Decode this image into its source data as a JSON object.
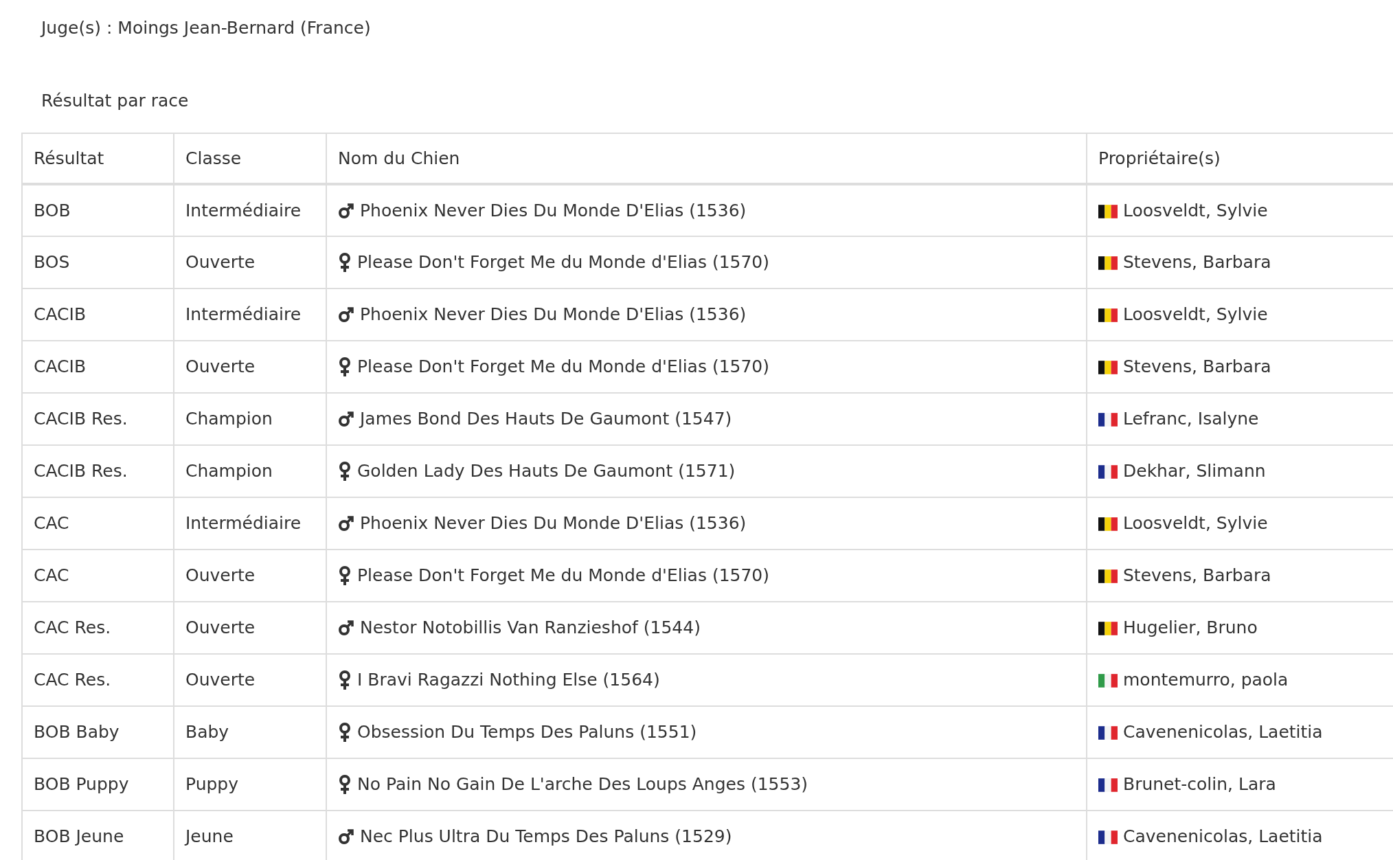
{
  "judge": "Juge(s) : Moings Jean-Bernard (France)",
  "section_title": "Résultat par race",
  "table": {
    "columns": [
      "Résultat",
      "Classe",
      "Nom du Chien",
      "Propriétaire(s)"
    ],
    "rows": [
      {
        "result": "BOB",
        "class": "Intermédiaire",
        "sex_icon": {
          "kind": "male"
        },
        "dog": "Phoenix Never Dies Du Monde D'Elias (1536)",
        "flag": {
          "kind": "belgium"
        },
        "owner": "Loosveldt, Sylvie"
      },
      {
        "result": "BOS",
        "class": "Ouverte",
        "sex_icon": {
          "kind": "female"
        },
        "dog": "Please Don't Forget Me du Monde d'Elias (1570)",
        "flag": {
          "kind": "belgium"
        },
        "owner": "Stevens, Barbara"
      },
      {
        "result": "CACIB",
        "class": "Intermédiaire",
        "sex_icon": {
          "kind": "male"
        },
        "dog": "Phoenix Never Dies Du Monde D'Elias (1536)",
        "flag": {
          "kind": "belgium"
        },
        "owner": "Loosveldt, Sylvie"
      },
      {
        "result": "CACIB",
        "class": "Ouverte",
        "sex_icon": {
          "kind": "female"
        },
        "dog": "Please Don't Forget Me du Monde d'Elias (1570)",
        "flag": {
          "kind": "belgium"
        },
        "owner": "Stevens, Barbara"
      },
      {
        "result": "CACIB Res.",
        "class": "Champion",
        "sex_icon": {
          "kind": "male"
        },
        "dog": "James Bond Des Hauts De Gaumont (1547)",
        "flag": {
          "kind": "france"
        },
        "owner": "Lefranc, Isalyne"
      },
      {
        "result": "CACIB Res.",
        "class": "Champion",
        "sex_icon": {
          "kind": "female"
        },
        "dog": "Golden Lady Des Hauts De Gaumont (1571)",
        "flag": {
          "kind": "france"
        },
        "owner": "Dekhar, Slimann"
      },
      {
        "result": "CAC",
        "class": "Intermédiaire",
        "sex_icon": {
          "kind": "male"
        },
        "dog": "Phoenix Never Dies Du Monde D'Elias (1536)",
        "flag": {
          "kind": "belgium"
        },
        "owner": "Loosveldt, Sylvie"
      },
      {
        "result": "CAC",
        "class": "Ouverte",
        "sex_icon": {
          "kind": "female"
        },
        "dog": "Please Don't Forget Me du Monde d'Elias (1570)",
        "flag": {
          "kind": "belgium"
        },
        "owner": "Stevens, Barbara"
      },
      {
        "result": "CAC Res.",
        "class": "Ouverte",
        "sex_icon": {
          "kind": "male"
        },
        "dog": "Nestor Notobillis Van Ranzieshof (1544)",
        "flag": {
          "kind": "belgium"
        },
        "owner": "Hugelier, Bruno"
      },
      {
        "result": "CAC Res.",
        "class": "Ouverte",
        "sex_icon": {
          "kind": "female"
        },
        "dog": "I Bravi Ragazzi Nothing Else (1564)",
        "flag": {
          "kind": "italy"
        },
        "owner": "montemurro, paola"
      },
      {
        "result": "BOB Baby",
        "class": "Baby",
        "sex_icon": {
          "kind": "female"
        },
        "dog": "Obsession Du Temps Des Paluns (1551)",
        "flag": {
          "kind": "france"
        },
        "owner": "Cavenenicolas, Laetitia"
      },
      {
        "result": "BOB Puppy",
        "class": "Puppy",
        "sex_icon": {
          "kind": "female"
        },
        "dog": "No Pain No Gain De L'arche Des Loups Anges (1553)",
        "flag": {
          "kind": "france"
        },
        "owner": "Brunet-colin, Lara"
      },
      {
        "result": "BOB Jeune",
        "class": "Jeune",
        "sex_icon": {
          "kind": "male"
        },
        "dog": "Nec Plus Ultra Du Temps Des Paluns (1529)",
        "flag": {
          "kind": "france"
        },
        "owner": "Cavenenicolas, Laetitia"
      }
    ]
  }
}
